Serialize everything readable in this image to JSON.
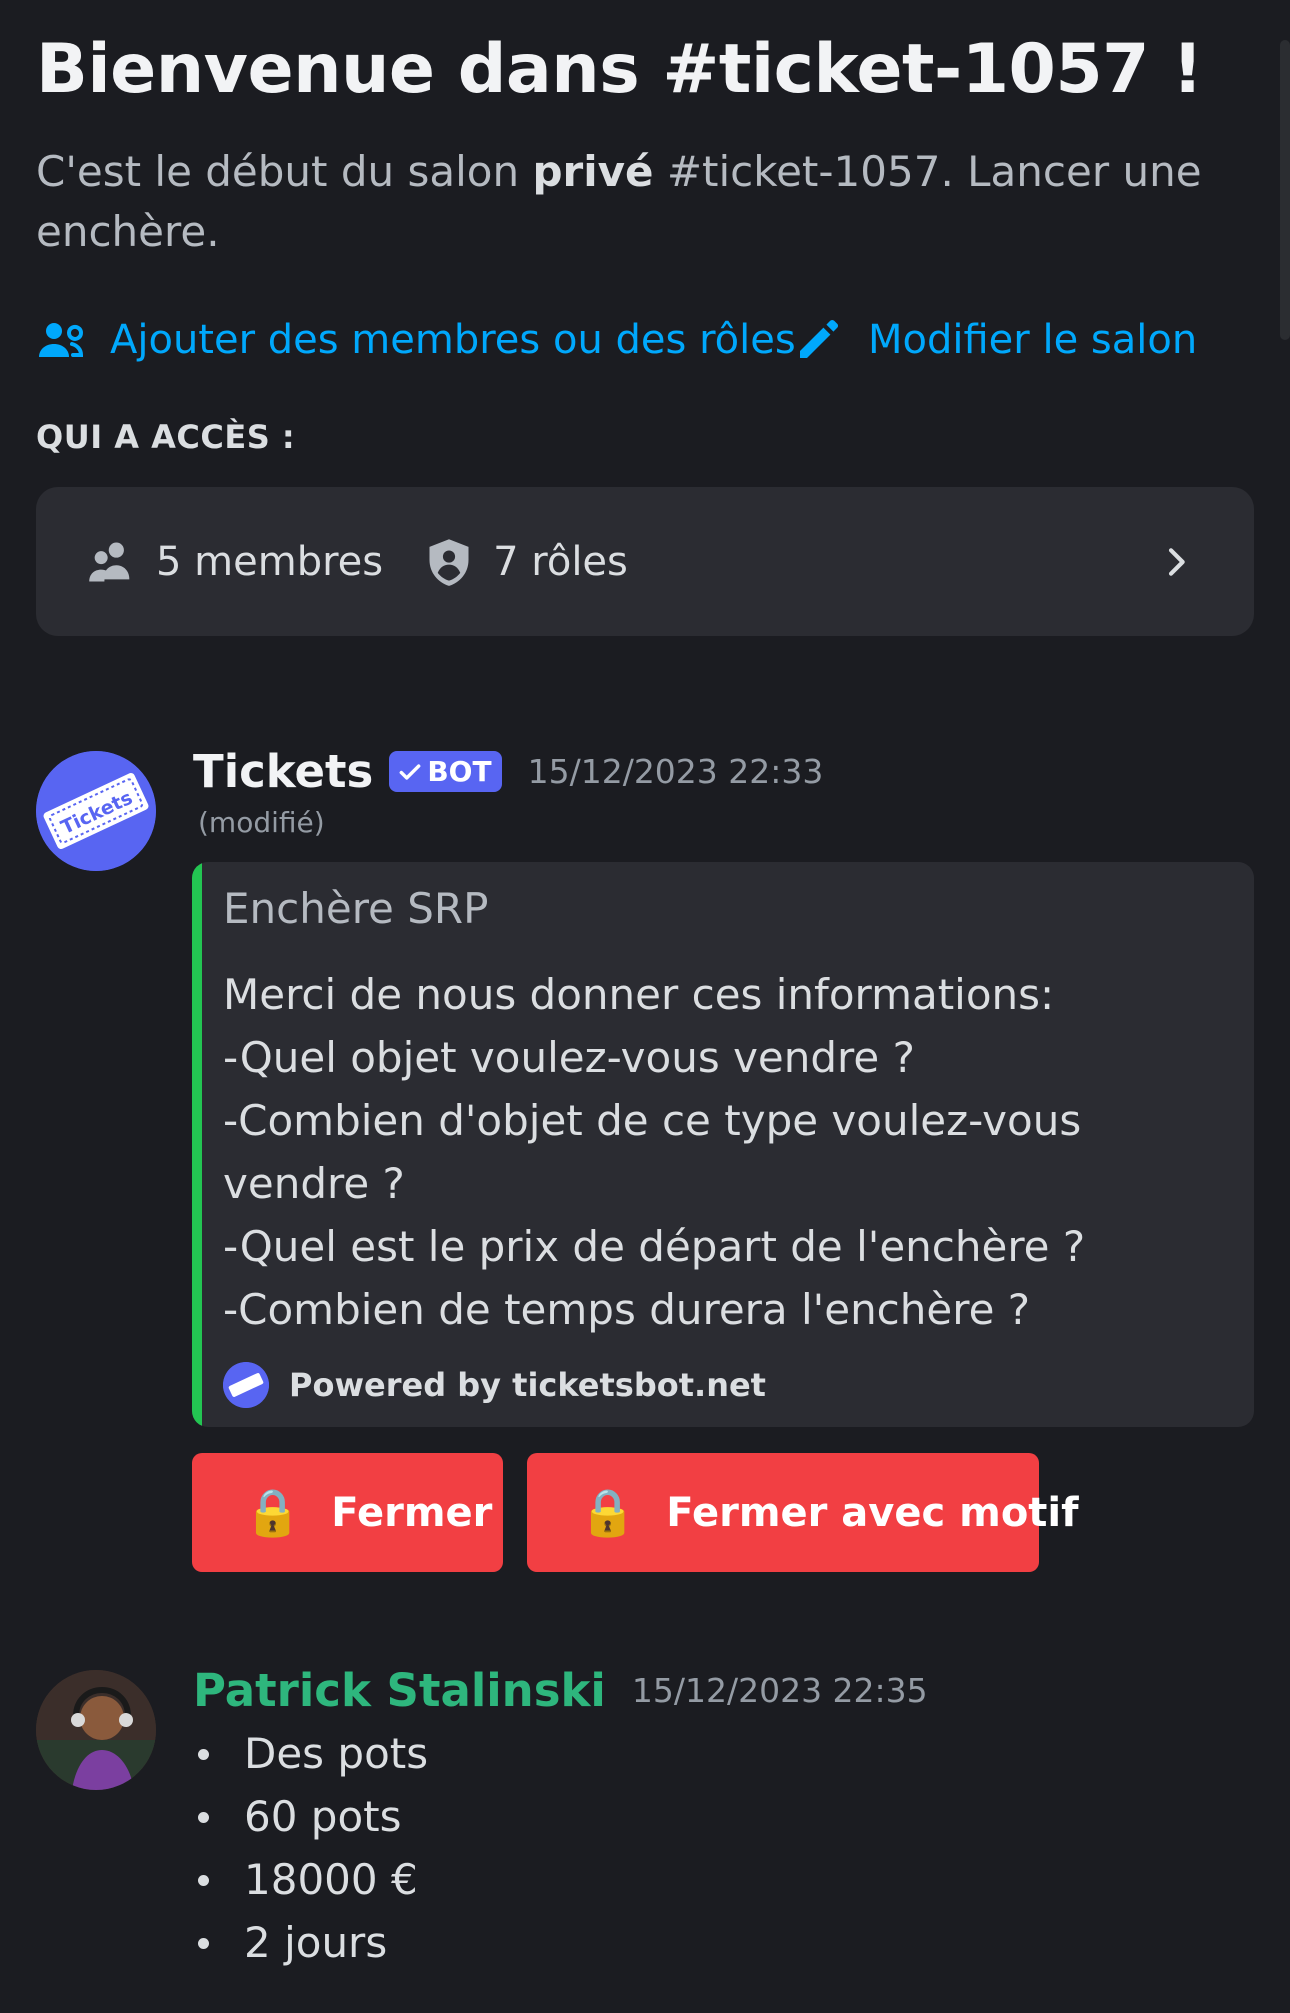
{
  "welcome": {
    "title": "Bienvenue dans #ticket-1057 !",
    "desc_before": "C'est le début du salon ",
    "desc_bold": "privé",
    "desc_after": " #ticket-1057. Lancer une enchère."
  },
  "actions": {
    "add_members": "Ajouter des membres ou des rôles",
    "edit_channel": "Modifier le salon"
  },
  "access": {
    "heading": "QUI A ACCÈS :",
    "members": "5 membres",
    "roles": "7 rôles"
  },
  "messages": {
    "bot": {
      "author": "Tickets",
      "tag": "BOT",
      "timestamp": "15/12/2023 22:33",
      "edited": "(modifié)",
      "embed": {
        "title": "Enchère SRP",
        "lines": [
          "Merci de nous donner ces informations:",
          "-Quel objet voulez-vous vendre ?",
          "-Combien d'objet de ce type voulez-vous vendre ?",
          "-Quel est le prix de départ de l'enchère ?",
          "-Combien de temps durera l'enchère ?"
        ],
        "footer": "Powered by ticketsbot.net",
        "accent_color": "#23c552"
      },
      "buttons": {
        "close": "Fermer",
        "close_reason": "Fermer avec motif",
        "icon": "🔒"
      }
    },
    "user": {
      "author": "Patrick Stalinski",
      "timestamp": "15/12/2023 22:35",
      "items": [
        "Des pots",
        "60 pots",
        "18000 €",
        "2 jours"
      ]
    }
  },
  "colors": {
    "background": "#1b1c21",
    "link": "#00a8fc",
    "danger": "#f23f43",
    "blurple": "#5865f2",
    "username_green": "#2eb67d"
  },
  "icons": {
    "add_members": "add-user-icon",
    "edit_channel": "pencil-icon",
    "members": "people-icon",
    "roles": "shield-icon",
    "chevron": "chevron-right-icon",
    "lock": "lock-icon"
  }
}
